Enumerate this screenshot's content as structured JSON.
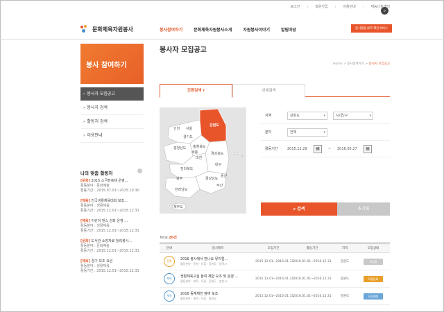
{
  "top_links": [
    "로그인",
    "회원가입",
    "이용안내",
    "재능나눔센터"
  ],
  "site": {
    "name": "문화체육자원봉사",
    "promo_label": "봉사활동내역 확인서비스"
  },
  "gnb": [
    "봉사참여하기",
    "문화체육자원봉사소개",
    "자원봉사이야기",
    "알림마당"
  ],
  "lnb": {
    "title": "봉사 참여하기",
    "items": [
      "봉사자 모집공고",
      "봉사자 검색",
      "활동처 검색",
      "이용안내"
    ]
  },
  "my_activity": {
    "title": "나의 맞춤 활동처",
    "items": [
      {
        "tag": "[문화]",
        "title": "2015 소극장축제 운영...",
        "l1": "활동분야 : 문화예술",
        "l2": "활동기간 : 2015.07.01~2015.10.30"
      },
      {
        "tag": "[체육]",
        "title": "전국생활체육대회 보조...",
        "l1": "활동분야 : 생활체육",
        "l2": "활동기간 : 2015.12.01~2015.12.31"
      },
      {
        "tag": "[체육]",
        "title": "어린이 댄스 강좌 운영 ...",
        "l1": "활동분야 : 생활체육",
        "l2": "활동기간 : 2015.12.01~2015.12.31"
      },
      {
        "tag": "[문화]",
        "title": "도서관 소장자료 정리봉사...",
        "l1": "활동분야 : 문화예술",
        "l2": "활동기간 : 2015.12.01~2015.12.31"
      },
      {
        "tag": "[체육]",
        "title": "경기 보조 요원",
        "l1": "활동분야 : 생활체육",
        "l2": "활동기간 : 2015.12.01~2015.12.31"
      }
    ]
  },
  "page": {
    "title": "봉사자 모집공고",
    "breadcrumb": [
      "Home",
      "봉사참여하기",
      "봉사자 모집공고"
    ]
  },
  "tabs": [
    {
      "label": "간편검색 ▾",
      "active": true
    },
    {
      "label": "상세검색",
      "active": false
    }
  ],
  "map_regions": [
    "강원도",
    "서울",
    "경기도",
    "인천",
    "충청북도",
    "충청남도",
    "세종",
    "대전",
    "경상북도",
    "대구",
    "전라북도",
    "경상남도",
    "울산",
    "광주",
    "부산",
    "전라남도",
    "제주도"
  ],
  "search_form": {
    "region_label": "지역",
    "region_value": "강원도",
    "district_value": "시/군/구",
    "field_label": "분야",
    "field_value": "전체",
    "period_label": "활동기간",
    "date_from": "2015.12.29",
    "date_sep": "~",
    "date_to": "2016.05.27",
    "search_button": "검색",
    "reset_button": "초기화"
  },
  "results": {
    "total_prefix": "Total",
    "total_count": "26건",
    "headers": [
      "분야",
      "봉사제목",
      "모집기간",
      "활동기간",
      "지역",
      "모집상태"
    ],
    "rows": [
      {
        "field": "문화",
        "title": "2016 봉사에서 만나요 뮤지컬...",
        "sub": "활동분야 · 문화 · 모집 · 강원도 · 광역시",
        "recruit": "2015.12.01~2016.01.31",
        "activity": "2016.01.01~2016.12.31",
        "region": "강원도",
        "status": "모집중",
        "status_color": "#c8c8c8",
        "circle": "orange"
      },
      {
        "field": "체육",
        "title": "생활체육교실 참여 체험 보조 및 운영 ...",
        "sub": "활동분야 · 체육 · 모집 · 강원도 · 춘천시",
        "recruit": "2015.12.01~2016.01.31",
        "activity": "2016.01.01~2016.12.31",
        "region": "강원도",
        "status": "모집완료",
        "status_color": "#e8a02a",
        "circle": "blue"
      },
      {
        "field": "체육",
        "title": "2016 동계체전 참여 보조",
        "sub": "활동분야 · 체육 · 모집 · 평창군",
        "recruit": "2015.12.01~2016.01.31",
        "activity": "2016.01.01~2016.12.31",
        "region": "강원도",
        "status": "모집예정",
        "status_color": "#6aa6d8",
        "circle": "blue"
      }
    ]
  },
  "colors": {
    "accent": "#e8552a",
    "gray": "#555555"
  }
}
